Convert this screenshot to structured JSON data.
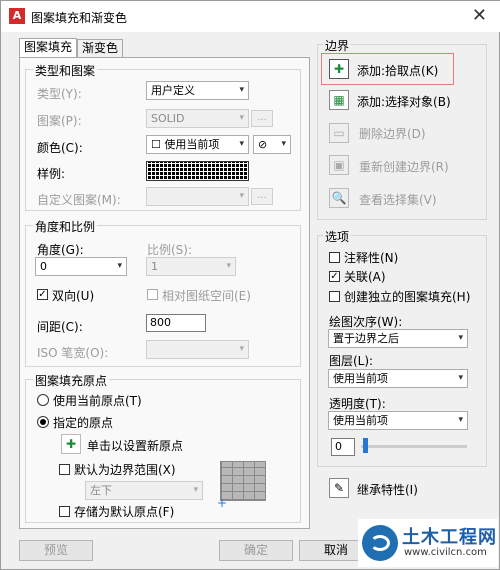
{
  "window": {
    "title": "图案填充和渐变色",
    "close_glyph": "✕",
    "app_icon_letter": "A"
  },
  "tabs": [
    {
      "label": "图案填充",
      "active": true
    },
    {
      "label": "渐变色",
      "active": false
    }
  ],
  "type_pattern": {
    "group_label": "类型和图案",
    "type_label": "类型(Y):",
    "type_value": "用户定义",
    "pattern_label": "图案(P):",
    "pattern_value": "SOLID",
    "color_label": "颜色(C):",
    "color_value": "☐ 使用当前项",
    "color_bg_value": "⊘",
    "sample_label": "样例:",
    "custom_label": "自定义图案(M):",
    "dots": "..."
  },
  "angle_scale": {
    "group_label": "角度和比例",
    "angle_label": "角度(G):",
    "angle_value": "0",
    "scale_label": "比例(S):",
    "scale_value": "1",
    "double_label": "双向(U)",
    "double_checked": true,
    "relative_label": "相对图纸空间(E)",
    "relative_checked": false,
    "spacing_label": "间距(C):",
    "spacing_value": "800",
    "iso_label": "ISO 笔宽(O):",
    "iso_value": ""
  },
  "origin": {
    "group_label": "图案填充原点",
    "use_current_label": "使用当前原点(T)",
    "specified_label": "指定的原点",
    "click_set_label": "单击以设置新原点",
    "default_extent_label": "默认为边界范围(X)",
    "extent_value": "左下",
    "store_default_label": "存储为默认原点(F)",
    "selected": "specified"
  },
  "boundary": {
    "group_label": "边界",
    "add_pick_label": "添加:拾取点(K)",
    "add_select_label": "添加:选择对象(B)",
    "remove_label": "删除边界(D)",
    "recreate_label": "重新创建边界(R)",
    "view_label": "查看选择集(V)"
  },
  "options": {
    "group_label": "选项",
    "annotative_label": "注释性(N)",
    "annotative_checked": false,
    "associative_label": "关联(A)",
    "associative_checked": true,
    "independent_label": "创建独立的图案填充(H)",
    "independent_checked": false,
    "draw_order_label": "绘图次序(W):",
    "draw_order_value": "置于边界之后",
    "layer_label": "图层(L):",
    "layer_value": "使用当前项",
    "transparency_label": "透明度(T):",
    "transparency_value": "使用当前项",
    "transparency_amount": "0"
  },
  "inherit_label": "继承特性(I)",
  "footer": {
    "preview_label": "预览",
    "ok_label": "确定",
    "cancel_label": "取消"
  },
  "watermark": {
    "main": "土木工程网",
    "sub": "www.civilcn.com"
  },
  "colors": {
    "highlight": "#e47a7a",
    "slider": "#2478d4",
    "watermark": "#1f5fa8"
  },
  "check_glyph": "✓"
}
